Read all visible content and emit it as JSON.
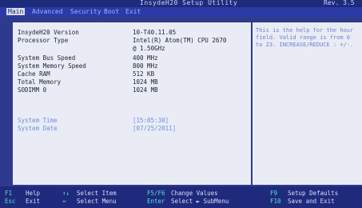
{
  "app": {
    "title": "InsydeH20 Setup Utility",
    "revision": "Rev. 3.5"
  },
  "menu": {
    "items": [
      {
        "label": "Main",
        "active": true
      },
      {
        "label": "Advanced",
        "active": false
      },
      {
        "label": "Security",
        "active": false
      },
      {
        "label": "Boot",
        "active": false
      },
      {
        "label": "Exit",
        "active": false
      }
    ]
  },
  "main": {
    "rows": [
      {
        "label": "InsydeH20 Version",
        "value": "10-T40.11.05"
      },
      {
        "label": "Processor Type",
        "value": "Intel(R) Atom(TM) CPU 2670"
      },
      {
        "label": "",
        "value": "@ 1.50GHz"
      },
      {
        "label": "System Bus Speed",
        "value": "400 MHz"
      },
      {
        "label": "System Memory Speed",
        "value": "800 MHz"
      },
      {
        "label": "Cache RAM",
        "value": "512 KB"
      },
      {
        "label": "Total Memory",
        "value": "1024 MB"
      },
      {
        "label": "SODIMM 0",
        "value": "1024 MB"
      }
    ],
    "system_time": {
      "label": "System Time",
      "value": "[15:05:30]"
    },
    "system_date": {
      "label": "System Date",
      "value": "[07/25/2011]"
    }
  },
  "help": {
    "text": "This is the help for the hour field. Valid range is from 0 to 23. INCREASE/REDUCE : +/-."
  },
  "footer": {
    "left_keys": [
      {
        "key": "F1",
        "desc": "Help"
      },
      {
        "key": "Esc",
        "desc": "Exit"
      }
    ],
    "mid_keys": [
      {
        "key": "↑↓",
        "desc": "Select Item"
      },
      {
        "key": "↔",
        "desc": "Select Menu"
      }
    ],
    "center_keys": [
      {
        "key": "F5/F6",
        "desc": "Change Values"
      },
      {
        "key": "Enter",
        "desc": "Select ► SubMenu"
      }
    ],
    "right_keys": [
      {
        "key": "F9",
        "desc": "Setup Defaults"
      },
      {
        "key": "F10",
        "desc": "Save and Exit"
      }
    ]
  }
}
